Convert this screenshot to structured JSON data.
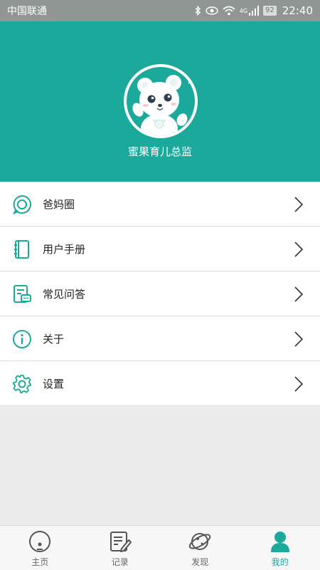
{
  "status_bar": {
    "carrier": "中国联通",
    "network": "4G",
    "battery": "92",
    "time": "22:40"
  },
  "profile": {
    "username": "蜜果育儿总监",
    "avatar_icon": "bear-avatar"
  },
  "menu": [
    {
      "label": "爸妈圈",
      "icon": "chat-circle-icon"
    },
    {
      "label": "用户手册",
      "icon": "notebook-icon"
    },
    {
      "label": "常见问答",
      "icon": "faq-document-icon"
    },
    {
      "label": "关于",
      "icon": "info-icon"
    },
    {
      "label": "设置",
      "icon": "gear-icon"
    }
  ],
  "tabs": [
    {
      "label": "主页",
      "icon": "home-disc-icon",
      "active": false
    },
    {
      "label": "记录",
      "icon": "record-edit-icon",
      "active": false
    },
    {
      "label": "发现",
      "icon": "planet-icon",
      "active": false
    },
    {
      "label": "我的",
      "icon": "user-icon",
      "active": true
    }
  ],
  "colors": {
    "accent": "#1aa99b",
    "status_bar": "#8f9694",
    "page_background": "#ececec"
  }
}
